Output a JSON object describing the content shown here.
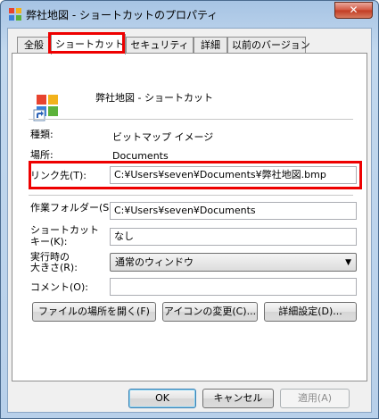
{
  "window": {
    "title": "弊社地図 - ショートカットのプロパティ",
    "close_label": "✕"
  },
  "tabs": [
    {
      "label": "全般"
    },
    {
      "label": "ショートカット"
    },
    {
      "label": "セキュリティ"
    },
    {
      "label": "詳細"
    },
    {
      "label": "以前のバージョン"
    }
  ],
  "shortcut": {
    "name": "弊社地図 - ショートカット",
    "type_label": "種類:",
    "type_value": "ビットマップ イメージ",
    "location_label": "場所:",
    "location_value": "Documents",
    "target_label": "リンク先(T):",
    "target_value": "C:¥Users¥seven¥Documents¥弊社地図.bmp",
    "workdir_label": "作業フォルダー(S):",
    "workdir_value": "C:¥Users¥seven¥Documents",
    "hotkey_label_1": "ショートカット",
    "hotkey_label_2": "キー(K):",
    "hotkey_value": "なし",
    "run_label_1": "実行時の",
    "run_label_2": "大きさ(R):",
    "run_value": "通常のウィンドウ",
    "comment_label": "コメント(O):",
    "comment_value": ""
  },
  "actions": {
    "open_location": "ファイルの場所を開く(F)",
    "change_icon": "アイコンの変更(C)...",
    "advanced": "詳細設定(D)..."
  },
  "footer": {
    "ok": "OK",
    "cancel": "キャンセル",
    "apply": "適用(A)"
  },
  "colors": {
    "highlight": "#e00000",
    "titlebar": "#b8d0ea"
  }
}
